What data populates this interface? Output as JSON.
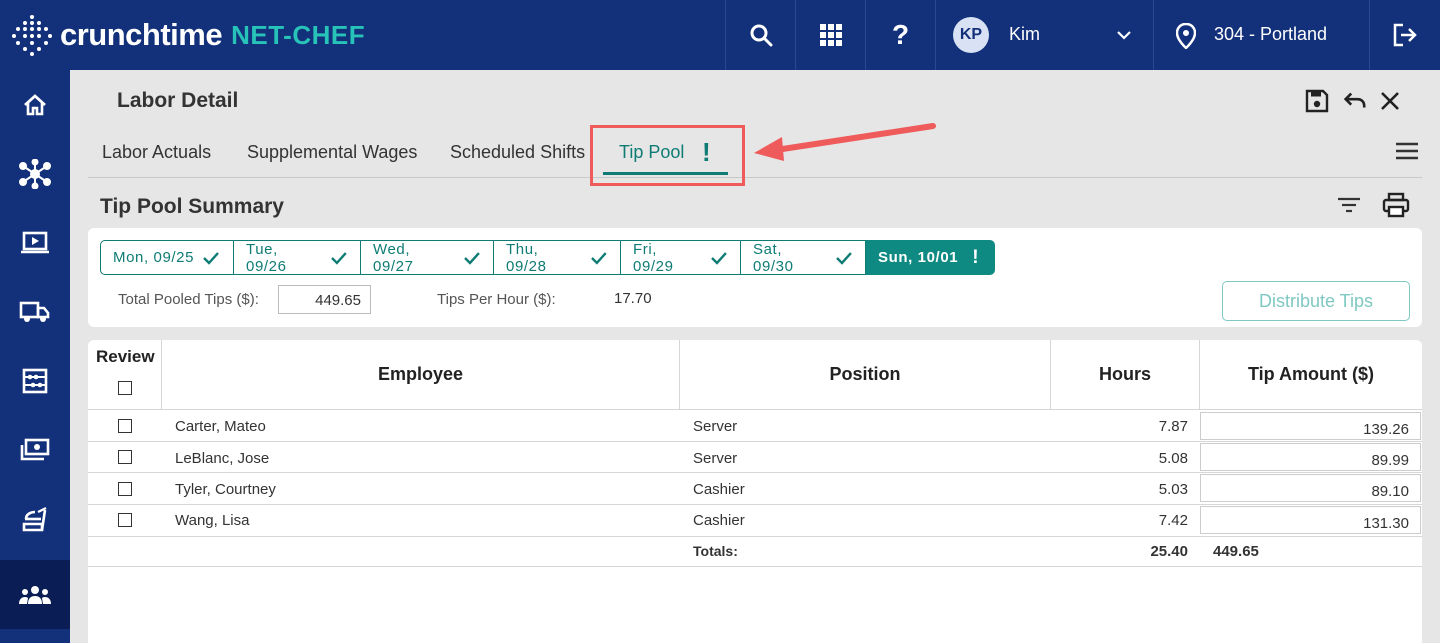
{
  "app": {
    "logo_word": "crunchtime",
    "logo_sub": "NET-CHEF"
  },
  "topbar": {
    "user_initials": "KP",
    "user_name": "Kim",
    "location": "304 - Portland",
    "icons": [
      "search-icon",
      "apps-grid-icon",
      "help-icon",
      "chevron-down-icon",
      "location-pin-icon",
      "logout-icon"
    ]
  },
  "sidebar": {
    "items": [
      {
        "icon": "home-icon"
      },
      {
        "icon": "network-icon"
      },
      {
        "icon": "monitor-play-icon"
      },
      {
        "icon": "truck-icon"
      },
      {
        "icon": "abacus-icon"
      },
      {
        "icon": "cash-icon"
      },
      {
        "icon": "food-tray-icon"
      },
      {
        "icon": "people-icon",
        "active": true
      }
    ]
  },
  "page": {
    "title": "Labor Detail",
    "header_icons": [
      "save-icon",
      "undo-icon",
      "close-icon"
    ]
  },
  "tabs": [
    {
      "label": "Labor Actuals"
    },
    {
      "label": "Supplemental Wages"
    },
    {
      "label": "Scheduled Shifts"
    },
    {
      "label": "Tip Pool",
      "active": true,
      "alert": "!"
    }
  ],
  "summary": {
    "title": "Tip Pool Summary",
    "days": [
      {
        "label": "Mon, 09/25",
        "status": "check"
      },
      {
        "label": "Tue, 09/26",
        "status": "check"
      },
      {
        "label": "Wed, 09/27",
        "status": "check"
      },
      {
        "label": "Thu, 09/28",
        "status": "check"
      },
      {
        "label": "Fri, 09/29",
        "status": "check"
      },
      {
        "label": "Sat, 09/30",
        "status": "check"
      },
      {
        "label": "Sun, 10/01",
        "status": "alert",
        "active": true
      }
    ],
    "total_pooled_label": "Total Pooled Tips ($):",
    "total_pooled_value": "449.65",
    "tips_per_hour_label": "Tips Per Hour ($):",
    "tips_per_hour_value": "17.70",
    "distribute_label": "Distribute Tips"
  },
  "table": {
    "headers": {
      "review": "Review",
      "employee": "Employee",
      "position": "Position",
      "hours": "Hours",
      "tip": "Tip Amount ($)"
    },
    "rows": [
      {
        "employee": "Carter, Mateo",
        "position": "Server",
        "hours": "7.87",
        "tip": "139.26"
      },
      {
        "employee": "LeBlanc, Jose",
        "position": "Server",
        "hours": "5.08",
        "tip": "89.99"
      },
      {
        "employee": "Tyler, Courtney",
        "position": "Cashier",
        "hours": "5.03",
        "tip": "89.10"
      },
      {
        "employee": "Wang, Lisa",
        "position": "Cashier",
        "hours": "7.42",
        "tip": "131.30"
      }
    ],
    "totals_label": "Totals:",
    "totals_hours": "25.40",
    "totals_tip": "449.65"
  },
  "colors": {
    "navy": "#13307a",
    "teal": "#0e7c74",
    "annotation_red": "#ef5a5a"
  }
}
